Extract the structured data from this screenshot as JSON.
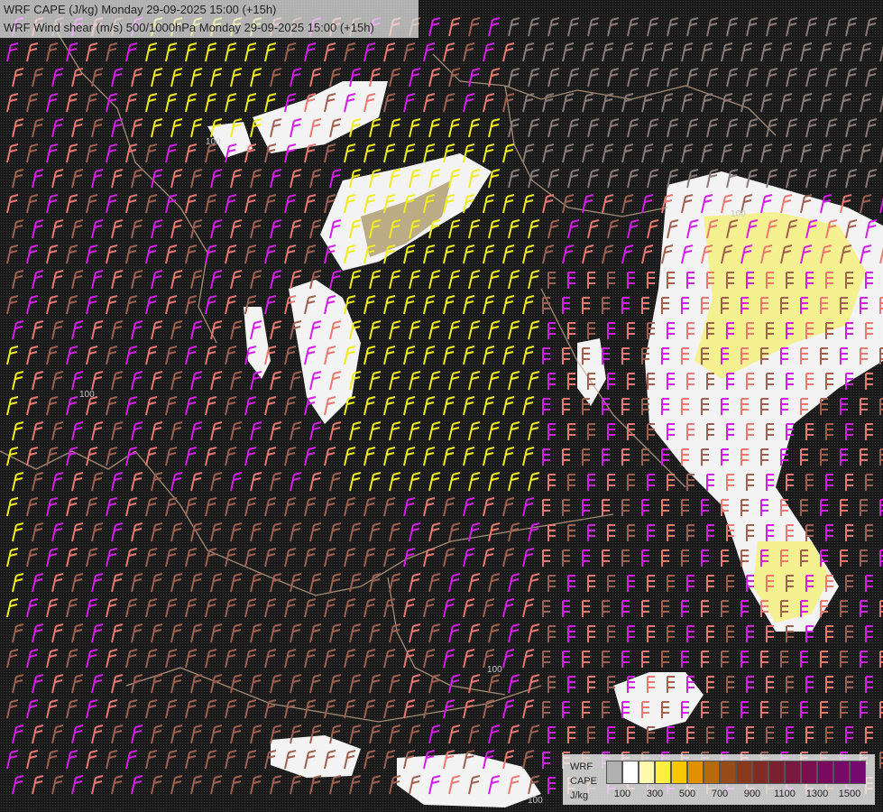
{
  "header": {
    "line1": "WRF CAPE (J/kg) Monday 29-09-2025 15:00 (+15h)",
    "line2": "WRF Wind shear (m/s) 500/1000hPa Monday 29-09-2025 15:00 (+15h)"
  },
  "legend": {
    "model": "WRF",
    "field": "CAPE",
    "unit": "J/kg",
    "tick_labels": [
      "100",
      "300",
      "500",
      "700",
      "900",
      "1100",
      "1300",
      "1500"
    ],
    "colors": [
      "#b0b0b0",
      "#ffffff",
      "#fff8b0",
      "#fff040",
      "#f5c800",
      "#e09000",
      "#b86a10",
      "#964b18",
      "#8a3a1c",
      "#7e2c24",
      "#7a2030",
      "#7a1840",
      "#7a1050",
      "#7a0a60",
      "#780a6a",
      "#760a72"
    ]
  },
  "map_colors": {
    "background": "#1a1a1a",
    "barb_magenta": "#d21ee6",
    "barb_salmon": "#e87870",
    "barb_brown": "#a06050",
    "barb_yellow": "#f0ec20",
    "barb_grey": "#8a7a78",
    "cape_white": "#ffffff",
    "cape_yellow": "#f6f08a",
    "border": "#c8a888"
  },
  "contour_labels": [
    "100",
    "100",
    "100",
    "100",
    "100"
  ]
}
